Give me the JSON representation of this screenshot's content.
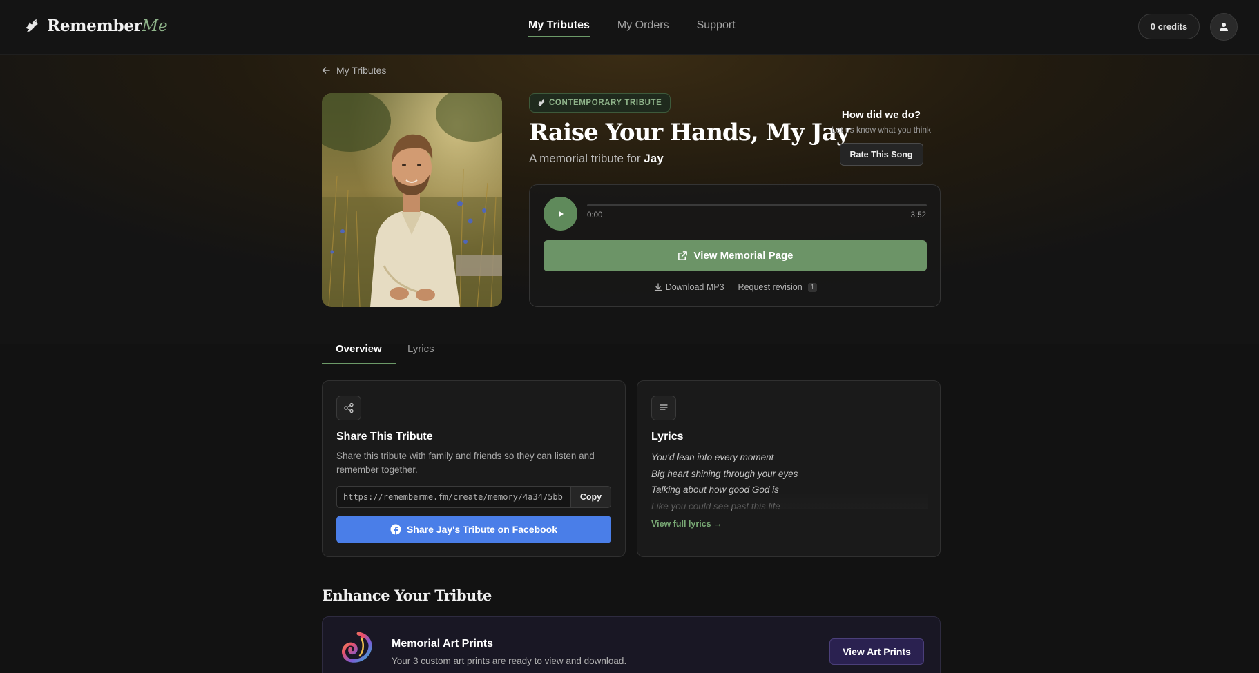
{
  "header": {
    "logo_main": "Remember",
    "logo_accent": "Me",
    "nav": [
      {
        "label": "My Tributes",
        "active": true
      },
      {
        "label": "My Orders",
        "active": false
      },
      {
        "label": "Support",
        "active": false
      }
    ],
    "credits": "0 credits",
    "avatar_icon": "user-icon"
  },
  "back": {
    "label": "My Tributes",
    "icon": "arrow-left-icon"
  },
  "tribute": {
    "badge": "CONTEMPORARY TRIBUTE",
    "title": "Raise Your Hands, My Jay",
    "subtitle_prefix": "A memorial tribute for",
    "subtitle_name": "Jay",
    "cover_alt": "Portrait painting of a smiling bearded man in a cream shirt sitting in a wildflower meadow"
  },
  "feedback": {
    "question": "How did we do?",
    "sub": "Let us know what you think",
    "button": "Rate This Song"
  },
  "player": {
    "current_time": "0:00",
    "total_time": "3:52",
    "progress": 0,
    "memorial_button": "View Memorial Page",
    "download": "Download MP3",
    "revision": "Request revision",
    "revision_count": "1"
  },
  "tabs": [
    {
      "label": "Overview",
      "active": true
    },
    {
      "label": "Lyrics",
      "active": false
    }
  ],
  "share": {
    "title": "Share This Tribute",
    "description": "Share this tribute with family and friends so they can listen and remember together.",
    "url": "https://rememberme.fm/create/memory/4a3475bb",
    "copy": "Copy",
    "facebook": "Share Jay's Tribute on Facebook"
  },
  "lyrics": {
    "title": "Lyrics",
    "lines": [
      "You'd lean into every moment",
      "Big heart shining through your eyes",
      "Talking about how good God is",
      "Like you could see past this life"
    ],
    "view_full": "View full lyrics →"
  },
  "enhance": {
    "title": "Enhance Your Tribute",
    "item_name": "Memorial Art Prints",
    "item_desc": "Your 3 custom art prints are ready to view and download.",
    "button": "View Art Prints"
  },
  "colors": {
    "accent": "#6c9467",
    "facebook": "#4a7ee8",
    "background": "#121212"
  }
}
